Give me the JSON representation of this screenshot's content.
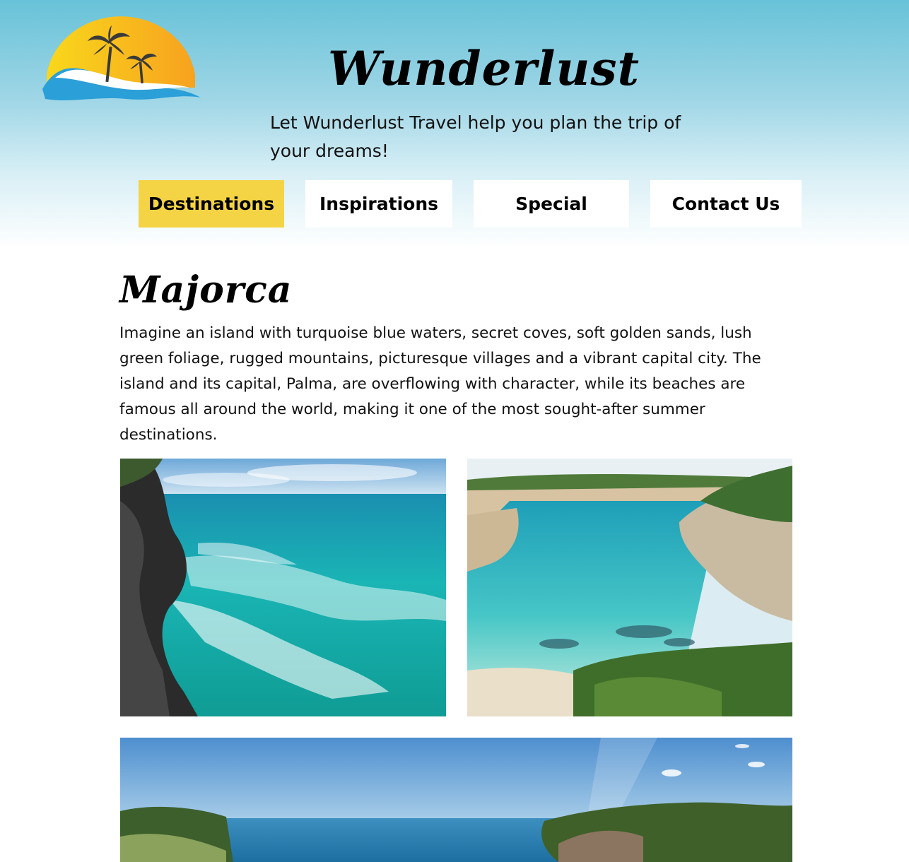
{
  "site": {
    "title": "Wunderlust",
    "tagline": "Let Wunderlust Travel help you plan the trip of your dreams!",
    "logo_icon": "sunset-palm-wave-logo"
  },
  "nav": {
    "items": [
      {
        "label": "Destinations",
        "active": true
      },
      {
        "label": "Inspirations",
        "active": false
      },
      {
        "label": "Special",
        "active": false
      },
      {
        "label": "Contact Us",
        "active": false
      }
    ]
  },
  "content": {
    "heading": "Majorca",
    "paragraph": "Imagine an island with turquoise blue waters, secret coves, soft golden sands, lush green foliage, rugged mountains, picturesque villages and a vibrant capital city. The island and its capital, Palma, are overflowing with character, while its beaches are famous all around the world, making it one of the most sought-after summer destinations."
  },
  "colors": {
    "header_top": "#68c2d8",
    "active_nav": "#f4d444",
    "turquoise": "#1fb3b0"
  }
}
